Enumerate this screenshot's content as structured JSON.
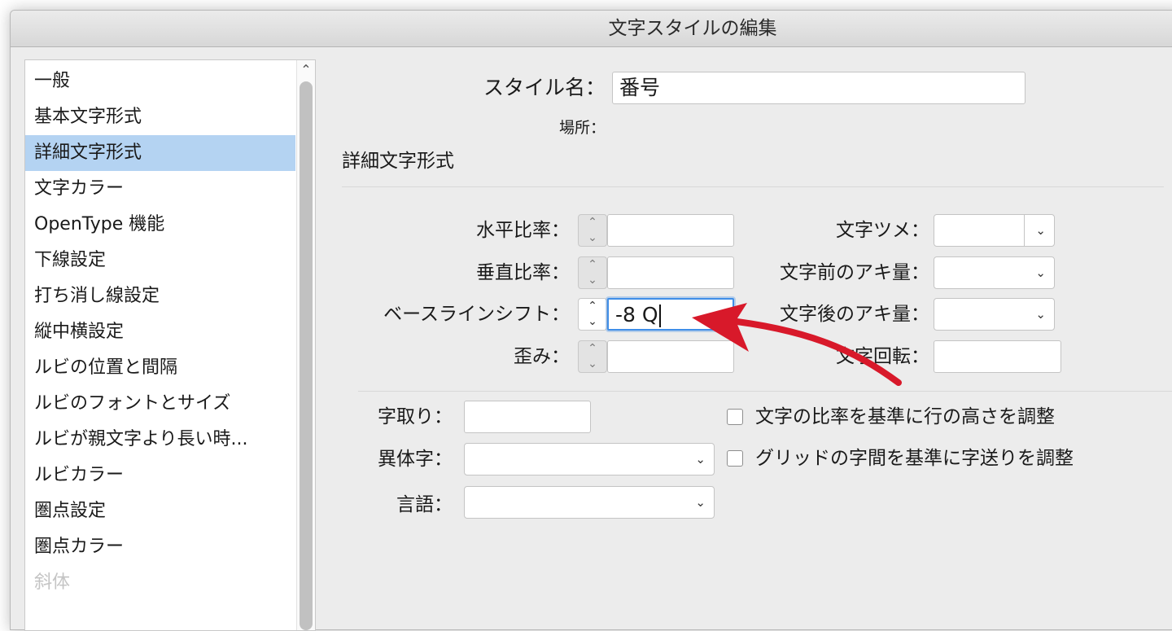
{
  "window": {
    "title": "文字スタイルの編集"
  },
  "sidebar": {
    "items": [
      {
        "label": "一般"
      },
      {
        "label": "基本文字形式"
      },
      {
        "label": "詳細文字形式",
        "selected": true
      },
      {
        "label": "文字カラー"
      },
      {
        "label": "OpenType 機能"
      },
      {
        "label": "下線設定"
      },
      {
        "label": "打ち消し線設定"
      },
      {
        "label": "縦中横設定"
      },
      {
        "label": "ルビの位置と間隔"
      },
      {
        "label": "ルビのフォントとサイズ"
      },
      {
        "label": "ルビが親文字より長い時..."
      },
      {
        "label": "ルビカラー"
      },
      {
        "label": "圏点設定"
      },
      {
        "label": "圏点カラー"
      },
      {
        "label": "斜体"
      }
    ],
    "scroll_up_icon": "chevron-up-icon"
  },
  "style_name": {
    "label": "スタイル名：",
    "value": "番号"
  },
  "location": {
    "label": "場所："
  },
  "section": {
    "title": "詳細文字形式"
  },
  "fields": {
    "horizontal_scale": {
      "label": "水平比率：",
      "value": ""
    },
    "vertical_scale": {
      "label": "垂直比率：",
      "value": ""
    },
    "baseline_shift": {
      "label": "ベースラインシフト：",
      "value": "-8 Q"
    },
    "skew": {
      "label": "歪み：",
      "value": ""
    },
    "tsume": {
      "label": "文字ツメ：",
      "value": ""
    },
    "aki_before": {
      "label": "文字前のアキ量：",
      "value": ""
    },
    "aki_after": {
      "label": "文字後のアキ量：",
      "value": ""
    },
    "rotation": {
      "label": "文字回転：",
      "value": ""
    },
    "jidori": {
      "label": "字取り：",
      "value": ""
    },
    "variant": {
      "label": "異体字：",
      "value": ""
    },
    "language": {
      "label": "言語：",
      "value": ""
    }
  },
  "checkboxes": {
    "scale_line_height": {
      "label": "文字の比率を基準に行の高さを調整",
      "checked": false
    },
    "grid_advance": {
      "label": "グリッドの字間を基準に字送りを調整",
      "checked": false
    }
  },
  "annotation": {
    "color": "#d8192a"
  }
}
